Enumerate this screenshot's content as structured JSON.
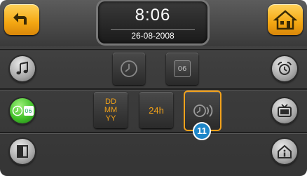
{
  "header": {
    "time": "8:06",
    "date": "26-08-2008"
  },
  "left_nav": [
    {
      "name": "music"
    },
    {
      "name": "clock-calendar",
      "active": true,
      "cal_label": "06"
    },
    {
      "name": "exit"
    }
  ],
  "right_nav": [
    {
      "name": "alarm"
    },
    {
      "name": "tv"
    },
    {
      "name": "home-info"
    }
  ],
  "tiles": {
    "row1": {
      "calendar_label": "06"
    },
    "row2": {
      "date_format": [
        "DD",
        "MM",
        "YY"
      ],
      "hour_format": "24h",
      "callout_number": "11"
    }
  },
  "colors": {
    "accent": "#f4a712",
    "active_green": "#42c12a",
    "callout_blue": "#1e86c8"
  }
}
